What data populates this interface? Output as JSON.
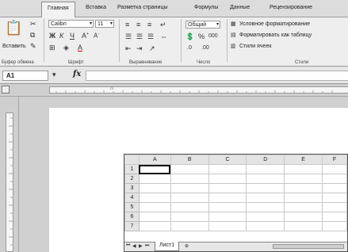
{
  "ribbon": {
    "tabs": [
      "Главная",
      "Вставка",
      "Разметка страницы",
      "Формулы",
      "Данные",
      "Рецензирование"
    ],
    "active_tab": "Главная",
    "groups": {
      "clipboard": {
        "label": "Буфер обмена",
        "paste_label": "Вставить"
      },
      "font": {
        "label": "Шрифт",
        "name": "Calibri",
        "size": "11"
      },
      "alignment": {
        "label": "Выравнивание"
      },
      "number": {
        "label": "Число",
        "format": "Общий"
      },
      "styles": {
        "label": "Стили",
        "items": [
          "Условное форматирование",
          "Форматировать как таблицу",
          "Стили ячеек"
        ]
      }
    }
  },
  "formula_bar": {
    "cell_ref": "A1",
    "fx": "fx",
    "value": ""
  },
  "sheet": {
    "columns": [
      "A",
      "B",
      "C",
      "D",
      "E",
      "F"
    ],
    "rows": [
      "1",
      "2",
      "3",
      "4",
      "5",
      "6",
      "7"
    ],
    "active_cell": "A1",
    "tab_name": "Лист1"
  },
  "icons": {
    "paste": "paste-icon",
    "cut": "scissors-icon",
    "copy": "copy-icon",
    "format_painter": "brush-icon",
    "bold": "bold-icon",
    "italic": "italic-icon",
    "underline": "underline-icon",
    "borders": "borders-icon",
    "fill": "fill-color-icon",
    "font_color": "font-color-icon",
    "align": "align-icon",
    "wrap": "wrap-text-icon",
    "merge": "merge-icon",
    "currency": "currency-icon",
    "percent": "percent-icon",
    "thousands": "thousands-icon"
  }
}
